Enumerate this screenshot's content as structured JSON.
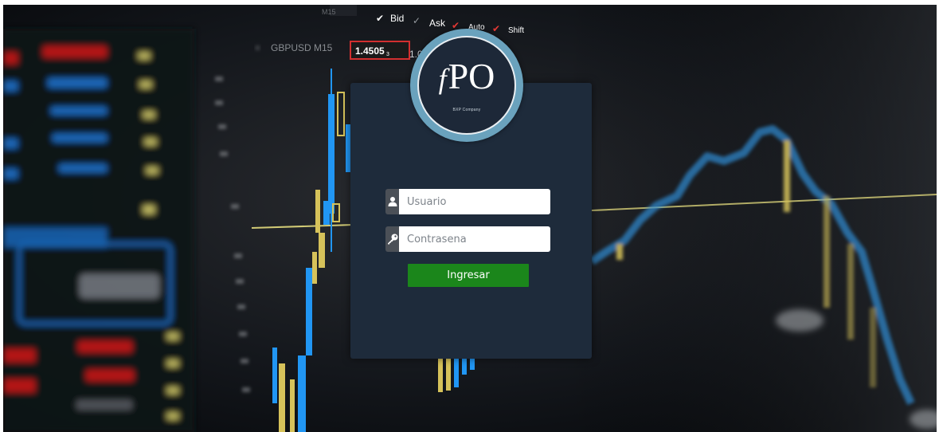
{
  "background": {
    "symbol_label": "GBPUSD M15",
    "price_label": "1.4505",
    "price_label_suffix": "3",
    "secondary_price": "1.0",
    "toolbar_items": [
      "Bid",
      "Ask",
      "Auto",
      "Shift"
    ]
  },
  "logo": {
    "mark_f": "f",
    "mark_text": "PO",
    "subtitle": "BXP Company"
  },
  "form": {
    "username_placeholder": "Usuario",
    "password_placeholder": "Contrasena",
    "submit_label": "Ingresar"
  },
  "icons": {
    "username": "user-icon",
    "password": "key-icon"
  },
  "colors": {
    "card": "#1e2b3b",
    "ring": "#6aa2bd",
    "submit": "#1b861b",
    "addon": "#4b5057"
  }
}
